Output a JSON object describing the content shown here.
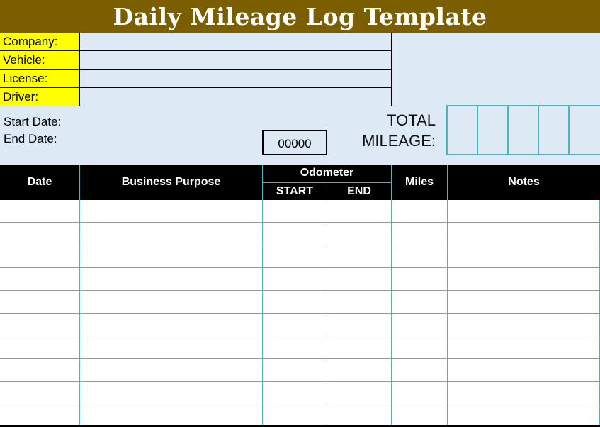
{
  "title": "Daily Mileage Log Template",
  "info_fields": [
    {
      "label": "Company:",
      "value": ""
    },
    {
      "label": "Vehicle:",
      "value": ""
    },
    {
      "label": "License:",
      "value": ""
    },
    {
      "label": "Driver:",
      "value": ""
    }
  ],
  "start_date_label": "Start Date:",
  "end_date_label": "End Date:",
  "odometer_value": "00000",
  "total_label_1": "TOTAL",
  "total_label_2": "MILEAGE:",
  "table": {
    "headers": {
      "date": "Date",
      "purpose": "Business Purpose",
      "odometer": "Odometer",
      "start": "START",
      "end": "END",
      "miles": "Miles",
      "notes": "Notes"
    },
    "rows": 10
  },
  "colors": {
    "header_bg": "#7b5e00",
    "label_bg": "#ffff00",
    "panel_bg": "#dde9f5",
    "grid": "#4bb5bf"
  }
}
